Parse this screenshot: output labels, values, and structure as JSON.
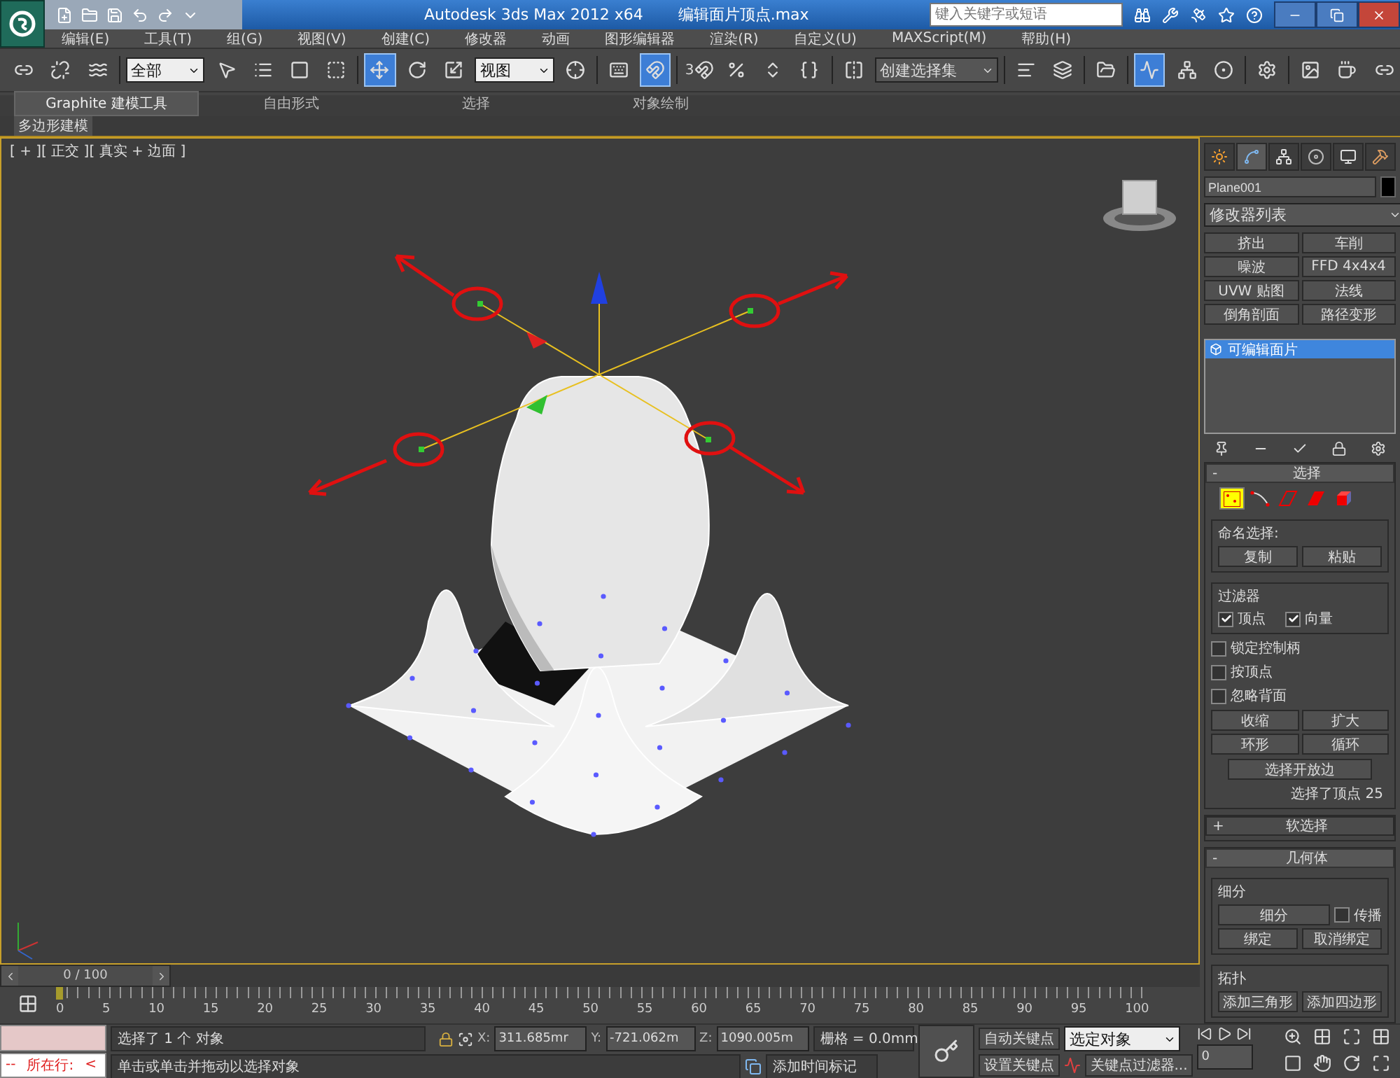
{
  "title_bar": {
    "app": "Autodesk 3ds Max  2012 x64",
    "file": "编辑面片顶点.max",
    "search_placeholder": "键入关键字或短语"
  },
  "menu": [
    "编辑(E)",
    "工具(T)",
    "组(G)",
    "视图(V)",
    "创建(C)",
    "修改器",
    "动画",
    "图形编辑器",
    "渲染(R)",
    "自定义(U)",
    "MAXScript(M)",
    "帮助(H)"
  ],
  "toolbar": [
    {
      "kind": "tool",
      "selected": false
    },
    {
      "kind": "tool",
      "selected": false
    },
    {
      "kind": "tool",
      "selected": false
    },
    {
      "kind": "sep"
    },
    {
      "kind": "dropdown",
      "value": "全部"
    },
    {
      "kind": "tool",
      "selected": false
    },
    {
      "kind": "tool",
      "selected": false
    },
    {
      "kind": "tool",
      "selected": false
    },
    {
      "kind": "tool",
      "selected": false
    },
    {
      "kind": "sep"
    },
    {
      "kind": "tool",
      "selected": true
    },
    {
      "kind": "tool",
      "selected": false
    },
    {
      "kind": "tool",
      "selected": false
    },
    {
      "kind": "dropdown",
      "value": "视图"
    },
    {
      "kind": "tool",
      "selected": false
    },
    {
      "kind": "sep"
    },
    {
      "kind": "tool",
      "selected": false
    },
    {
      "kind": "tool",
      "selected": true
    },
    {
      "kind": "sep"
    },
    {
      "kind": "tool",
      "selected": false,
      "label": "3"
    },
    {
      "kind": "tool",
      "selected": false
    },
    {
      "kind": "tool",
      "selected": false
    },
    {
      "kind": "tool",
      "selected": false
    },
    {
      "kind": "sep"
    },
    {
      "kind": "tool",
      "selected": false
    },
    {
      "kind": "dropdown",
      "value": "创建选择集"
    },
    {
      "kind": "sep"
    },
    {
      "kind": "tool",
      "selected": false
    },
    {
      "kind": "tool",
      "selected": false
    },
    {
      "kind": "sep"
    },
    {
      "kind": "tool",
      "selected": false
    },
    {
      "kind": "sep"
    },
    {
      "kind": "tool",
      "selected": true
    },
    {
      "kind": "tool",
      "selected": false
    },
    {
      "kind": "tool",
      "selected": false
    },
    {
      "kind": "sep"
    },
    {
      "kind": "tool",
      "selected": false
    },
    {
      "kind": "sep"
    },
    {
      "kind": "tool",
      "selected": false
    },
    {
      "kind": "tool",
      "selected": false
    },
    {
      "kind": "tool",
      "selected": false
    }
  ],
  "ribbon": {
    "tabs": [
      {
        "label": "Graphite 建模工具",
        "selected": true
      },
      {
        "label": "自由形式",
        "selected": false
      },
      {
        "label": "选择",
        "selected": false
      },
      {
        "label": "对象绘制",
        "selected": false
      }
    ],
    "panel": "多边形建模"
  },
  "viewport": {
    "label": "[ + ][ 正交 ][ 真实 + 边面 ]"
  },
  "command_panel": {
    "tabs": [
      {
        "selected": false
      },
      {
        "selected": true
      },
      {
        "selected": false
      },
      {
        "selected": false
      },
      {
        "selected": false
      },
      {
        "selected": false
      }
    ],
    "object_name": "Plane001",
    "modifier_list": "修改器列表",
    "modifier_buttons": [
      "挤出",
      "车削",
      "噪波",
      "FFD 4x4x4",
      "UVW 贴图",
      "法线",
      "倒角剖面",
      "路径变形"
    ],
    "stack": [
      {
        "label": "可编辑面片",
        "selected": true
      }
    ],
    "selection": {
      "toggle": "-",
      "title": "选择",
      "expanded": true,
      "levels": [
        {
          "selected": true
        },
        {
          "selected": false
        },
        {
          "selected": false
        },
        {
          "selected": false
        },
        {
          "selected": false
        }
      ],
      "named_label": "命名选择:",
      "named_buttons": [
        "复制",
        "粘贴"
      ],
      "filter_label": "过滤器",
      "filters": [
        {
          "label": "顶点",
          "checked": true
        },
        {
          "label": "向量",
          "checked": true
        }
      ],
      "options": [
        {
          "label": "锁定控制柄",
          "checked": false
        },
        {
          "label": "按顶点",
          "checked": false
        },
        {
          "label": "忽略背面",
          "checked": false
        }
      ],
      "buttons": [
        "收缩",
        "扩大",
        "环形",
        "循环"
      ],
      "open_edges": "选择开放边",
      "status": "选择了顶点 25"
    },
    "soft_selection": {
      "toggle": "+",
      "title": "软选择",
      "expanded": false
    },
    "geometry": {
      "toggle": "-",
      "title": "几何体",
      "expanded": true,
      "subdivide_label": "细分",
      "subdivide": "细分",
      "propagate": {
        "label": "传播",
        "checked": false
      },
      "bind": "绑定",
      "unbind": "取消绑定",
      "topology_label": "拓扑",
      "topology_buttons": [
        "添加三角形",
        "添加四边形"
      ]
    }
  },
  "timeline": {
    "position": "0 / 100",
    "level": 0,
    "ticks": [
      "0",
      "5",
      "10",
      "15",
      "20",
      "25",
      "30",
      "35",
      "40",
      "45",
      "50",
      "55",
      "60",
      "65",
      "70",
      "75",
      "80",
      "85",
      "90",
      "95",
      "100"
    ]
  },
  "status": {
    "script_prefix": "--",
    "script_line": "所在行:",
    "script_arrow": "<",
    "selection": "选择了 1 个 对象",
    "prompt": "单击或单击并拖动以选择对象",
    "x_label": "X:",
    "x": "311.685mr",
    "y_label": "Y:",
    "y": "-721.062m",
    "z_label": "Z:",
    "z": "1090.005m",
    "grid": "栅格 = 0.0mm",
    "add_tag": "添加时间标记",
    "auto_key": "自动关键点",
    "set_key": "设置关键点",
    "key_mode": "选定对象",
    "key_filters": "关键点过滤器...",
    "frame": "0"
  }
}
